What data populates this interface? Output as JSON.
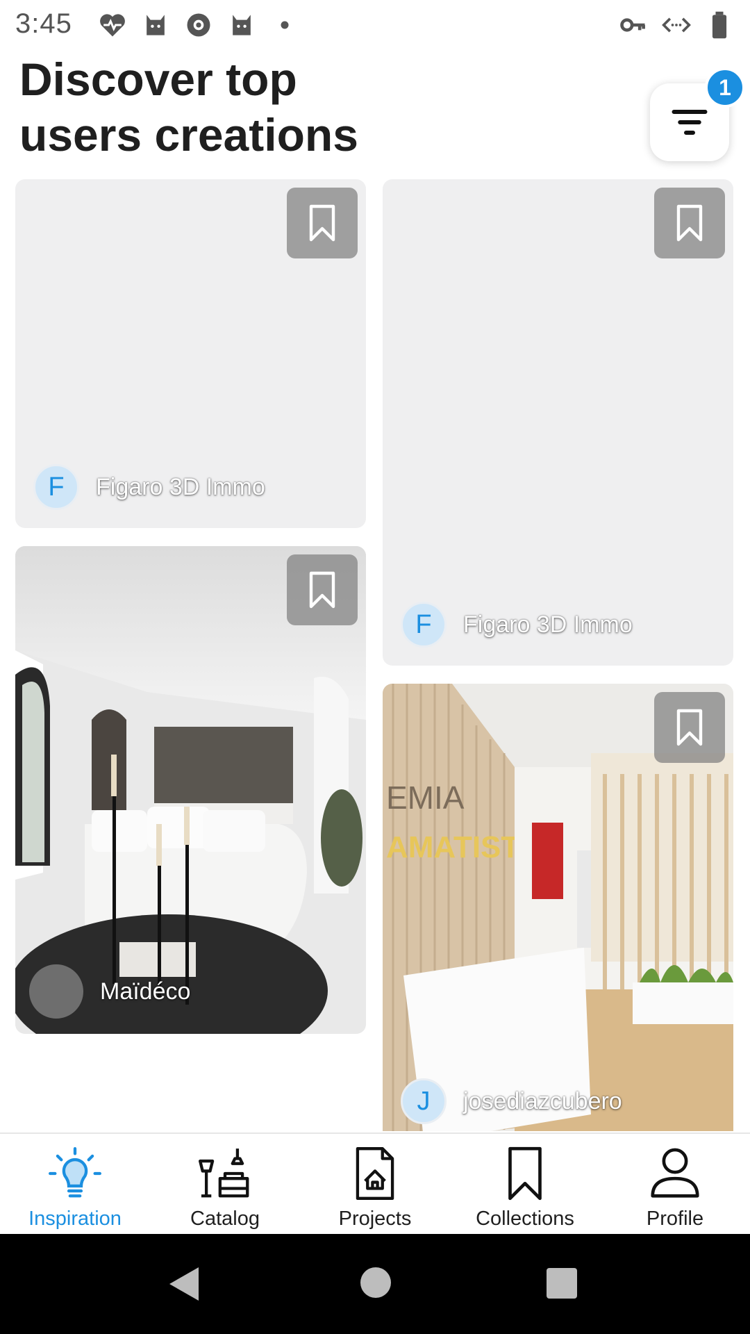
{
  "status_bar": {
    "time": "3:45",
    "left_icons": [
      "heart-pulse-icon",
      "cat-icon",
      "settings-blob-icon",
      "cat-icon",
      "dot-icon"
    ],
    "right_icons": [
      "key-icon",
      "data-saver-icon",
      "battery-icon"
    ]
  },
  "header": {
    "title": "Discover top\nusers creations",
    "filter_badge": "1"
  },
  "feed": {
    "cards": [
      {
        "author": "Figaro 3D Immo",
        "avatar_letter": "F"
      },
      {
        "author": "Figaro 3D Immo",
        "avatar_letter": "F"
      },
      {
        "author": "Maïdéco",
        "avatar_letter": ""
      },
      {
        "author": "josediazcubero",
        "avatar_letter": "J"
      }
    ]
  },
  "nav": {
    "items": [
      {
        "label": "Inspiration",
        "icon": "lightbulb-icon",
        "active": true
      },
      {
        "label": "Catalog",
        "icon": "furniture-icon"
      },
      {
        "label": "Projects",
        "icon": "house-document-icon"
      },
      {
        "label": "Collections",
        "icon": "bookmark-icon"
      },
      {
        "label": "Profile",
        "icon": "person-icon"
      }
    ]
  },
  "colors": {
    "accent": "#1b8fe0",
    "card_bg": "#efeff0",
    "text": "#1f1f1f"
  }
}
